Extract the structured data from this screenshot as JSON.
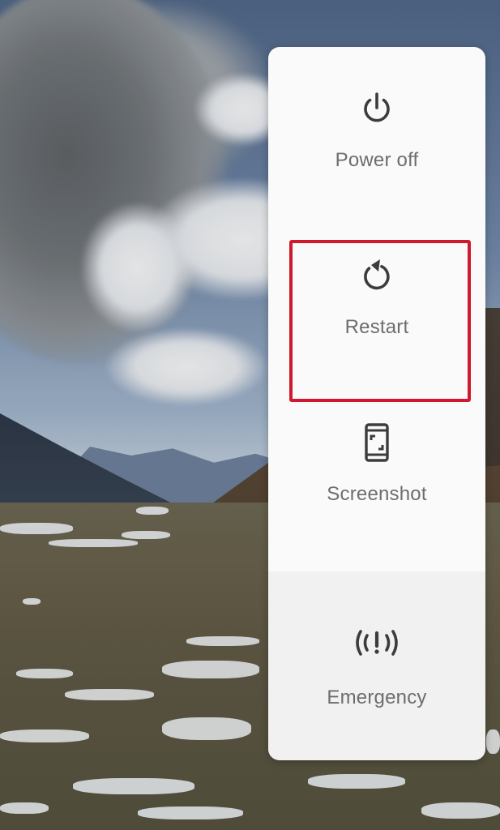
{
  "power_menu": {
    "items": [
      {
        "id": "power_off",
        "label": "Power off",
        "icon": "power-icon"
      },
      {
        "id": "restart",
        "label": "Restart",
        "icon": "restart-icon"
      },
      {
        "id": "screenshot",
        "label": "Screenshot",
        "icon": "screenshot-icon"
      },
      {
        "id": "emergency",
        "label": "Emergency",
        "icon": "emergency-icon"
      }
    ],
    "highlighted_item": "Restart"
  },
  "colors": {
    "panel_background": "#fafafa",
    "emergency_background": "#f1f1f1",
    "label_text": "#6d6d6d",
    "icon": "#3c3c3c",
    "highlight_border": "#d0192c"
  }
}
